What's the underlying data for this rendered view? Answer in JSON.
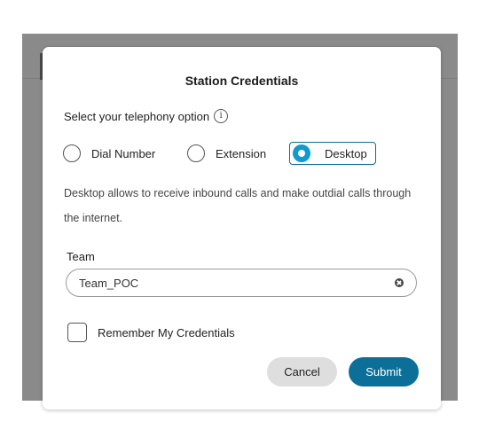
{
  "dialog": {
    "title": "Station Credentials",
    "prompt": "Select your telephony option",
    "info_icon": "info-icon",
    "options": [
      {
        "label": "Dial Number",
        "selected": false
      },
      {
        "label": "Extension",
        "selected": false
      },
      {
        "label": "Desktop",
        "selected": true
      }
    ],
    "description": "Desktop allows to receive inbound calls and make outdial calls through the internet.",
    "team": {
      "label": "Team",
      "value": "Team_POC"
    },
    "remember": {
      "label": "Remember My Credentials",
      "checked": false
    },
    "buttons": {
      "cancel": "Cancel",
      "submit": "Submit"
    }
  },
  "colors": {
    "accent": "#0d9bd1",
    "primary_button": "#0b6f98",
    "secondary_button": "#dedede",
    "backdrop": "#8a8a8a"
  }
}
